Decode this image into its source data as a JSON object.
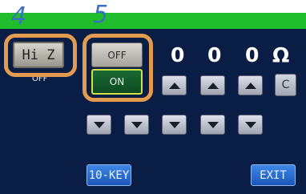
{
  "callouts": {
    "hiz_number": "4",
    "switch_number": "5"
  },
  "hiz": {
    "button_label": "Hi Z",
    "state_text": "OFF"
  },
  "toggle": {
    "off_label": "OFF",
    "on_label": "ON"
  },
  "value_display": {
    "digit1": "0",
    "digit2": "0",
    "digit3": "0",
    "unit": "Ω"
  },
  "keypad": {
    "clear_label": "C",
    "tenkey_label": "10-KEY",
    "exit_label": "EXIT"
  },
  "icons": {
    "up_arrow": "up-arrow-icon",
    "down_arrow": "down-arrow-icon"
  },
  "colors": {
    "panel_background": "#0a1d44",
    "title_strip": "#20bd2c",
    "callout_frame": "#e39b50",
    "callout_number": "#3a71c6",
    "on_button_border": "#cfdf45",
    "blue_button": "#2a6cd0"
  }
}
